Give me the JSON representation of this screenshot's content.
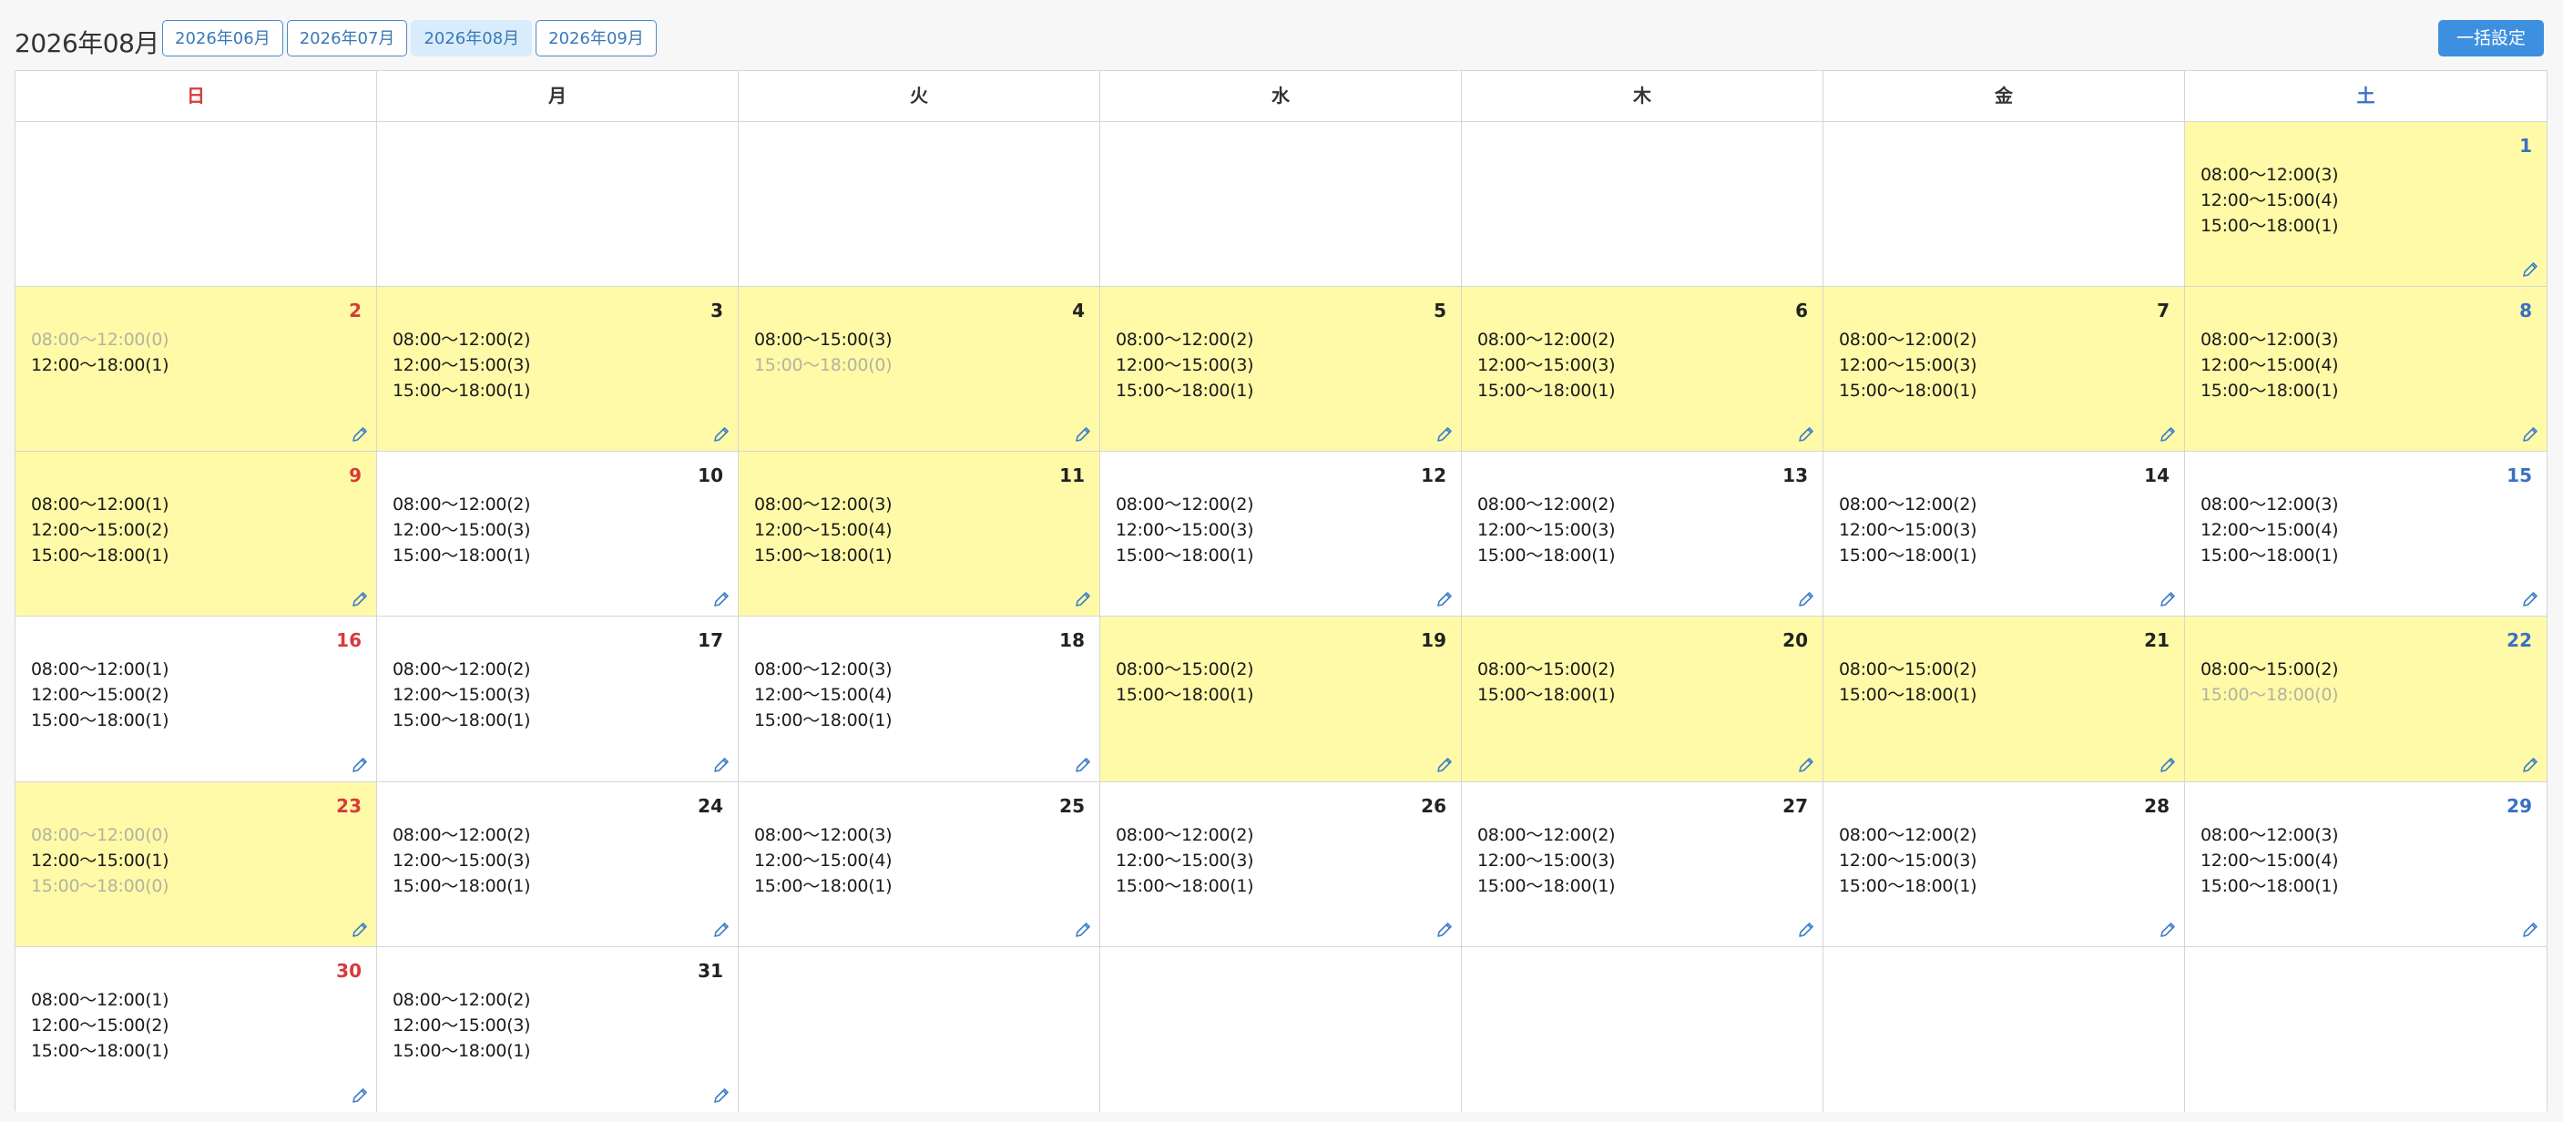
{
  "header": {
    "month_title": "2026年08月",
    "months": [
      {
        "label": "2026年06月",
        "active": false
      },
      {
        "label": "2026年07月",
        "active": false
      },
      {
        "label": "2026年08月",
        "active": true
      },
      {
        "label": "2026年09月",
        "active": false
      }
    ],
    "bulk_label": "一括設定"
  },
  "colors": {
    "highlight": "#fffaa8",
    "sunday": "#d83a3a",
    "saturday": "#3a6fc4",
    "accent": "#3d8fe0",
    "muted": "#b3b3a0"
  },
  "weekdays": [
    "日",
    "月",
    "火",
    "水",
    "木",
    "金",
    "土"
  ],
  "icons": {
    "edit": "pencil-icon"
  },
  "days": [
    {
      "day": "1",
      "highlight": true,
      "slots": [
        {
          "text": "08:00〜12:00(3)",
          "zero": false
        },
        {
          "text": "12:00〜15:00(4)",
          "zero": false
        },
        {
          "text": "15:00〜18:00(1)",
          "zero": false
        }
      ]
    },
    {
      "day": "2",
      "highlight": true,
      "slots": [
        {
          "text": "08:00〜12:00(0)",
          "zero": true
        },
        {
          "text": "12:00〜18:00(1)",
          "zero": false
        }
      ]
    },
    {
      "day": "3",
      "highlight": true,
      "slots": [
        {
          "text": "08:00〜12:00(2)",
          "zero": false
        },
        {
          "text": "12:00〜15:00(3)",
          "zero": false
        },
        {
          "text": "15:00〜18:00(1)",
          "zero": false
        }
      ]
    },
    {
      "day": "4",
      "highlight": true,
      "slots": [
        {
          "text": "08:00〜15:00(3)",
          "zero": false
        },
        {
          "text": "15:00〜18:00(0)",
          "zero": true
        }
      ]
    },
    {
      "day": "5",
      "highlight": true,
      "slots": [
        {
          "text": "08:00〜12:00(2)",
          "zero": false
        },
        {
          "text": "12:00〜15:00(3)",
          "zero": false
        },
        {
          "text": "15:00〜18:00(1)",
          "zero": false
        }
      ]
    },
    {
      "day": "6",
      "highlight": true,
      "slots": [
        {
          "text": "08:00〜12:00(2)",
          "zero": false
        },
        {
          "text": "12:00〜15:00(3)",
          "zero": false
        },
        {
          "text": "15:00〜18:00(1)",
          "zero": false
        }
      ]
    },
    {
      "day": "7",
      "highlight": true,
      "slots": [
        {
          "text": "08:00〜12:00(2)",
          "zero": false
        },
        {
          "text": "12:00〜15:00(3)",
          "zero": false
        },
        {
          "text": "15:00〜18:00(1)",
          "zero": false
        }
      ]
    },
    {
      "day": "8",
      "highlight": true,
      "slots": [
        {
          "text": "08:00〜12:00(3)",
          "zero": false
        },
        {
          "text": "12:00〜15:00(4)",
          "zero": false
        },
        {
          "text": "15:00〜18:00(1)",
          "zero": false
        }
      ]
    },
    {
      "day": "9",
      "highlight": true,
      "slots": [
        {
          "text": "08:00〜12:00(1)",
          "zero": false
        },
        {
          "text": "12:00〜15:00(2)",
          "zero": false
        },
        {
          "text": "15:00〜18:00(1)",
          "zero": false
        }
      ]
    },
    {
      "day": "10",
      "highlight": false,
      "slots": [
        {
          "text": "08:00〜12:00(2)",
          "zero": false
        },
        {
          "text": "12:00〜15:00(3)",
          "zero": false
        },
        {
          "text": "15:00〜18:00(1)",
          "zero": false
        }
      ]
    },
    {
      "day": "11",
      "highlight": true,
      "slots": [
        {
          "text": "08:00〜12:00(3)",
          "zero": false
        },
        {
          "text": "12:00〜15:00(4)",
          "zero": false
        },
        {
          "text": "15:00〜18:00(1)",
          "zero": false
        }
      ]
    },
    {
      "day": "12",
      "highlight": false,
      "slots": [
        {
          "text": "08:00〜12:00(2)",
          "zero": false
        },
        {
          "text": "12:00〜15:00(3)",
          "zero": false
        },
        {
          "text": "15:00〜18:00(1)",
          "zero": false
        }
      ]
    },
    {
      "day": "13",
      "highlight": false,
      "slots": [
        {
          "text": "08:00〜12:00(2)",
          "zero": false
        },
        {
          "text": "12:00〜15:00(3)",
          "zero": false
        },
        {
          "text": "15:00〜18:00(1)",
          "zero": false
        }
      ]
    },
    {
      "day": "14",
      "highlight": false,
      "slots": [
        {
          "text": "08:00〜12:00(2)",
          "zero": false
        },
        {
          "text": "12:00〜15:00(3)",
          "zero": false
        },
        {
          "text": "15:00〜18:00(1)",
          "zero": false
        }
      ]
    },
    {
      "day": "15",
      "highlight": false,
      "slots": [
        {
          "text": "08:00〜12:00(3)",
          "zero": false
        },
        {
          "text": "12:00〜15:00(4)",
          "zero": false
        },
        {
          "text": "15:00〜18:00(1)",
          "zero": false
        }
      ]
    },
    {
      "day": "16",
      "highlight": false,
      "slots": [
        {
          "text": "08:00〜12:00(1)",
          "zero": false
        },
        {
          "text": "12:00〜15:00(2)",
          "zero": false
        },
        {
          "text": "15:00〜18:00(1)",
          "zero": false
        }
      ]
    },
    {
      "day": "17",
      "highlight": false,
      "slots": [
        {
          "text": "08:00〜12:00(2)",
          "zero": false
        },
        {
          "text": "12:00〜15:00(3)",
          "zero": false
        },
        {
          "text": "15:00〜18:00(1)",
          "zero": false
        }
      ]
    },
    {
      "day": "18",
      "highlight": false,
      "slots": [
        {
          "text": "08:00〜12:00(3)",
          "zero": false
        },
        {
          "text": "12:00〜15:00(4)",
          "zero": false
        },
        {
          "text": "15:00〜18:00(1)",
          "zero": false
        }
      ]
    },
    {
      "day": "19",
      "highlight": true,
      "slots": [
        {
          "text": "08:00〜15:00(2)",
          "zero": false
        },
        {
          "text": "15:00〜18:00(1)",
          "zero": false
        }
      ]
    },
    {
      "day": "20",
      "highlight": true,
      "slots": [
        {
          "text": "08:00〜15:00(2)",
          "zero": false
        },
        {
          "text": "15:00〜18:00(1)",
          "zero": false
        }
      ]
    },
    {
      "day": "21",
      "highlight": true,
      "slots": [
        {
          "text": "08:00〜15:00(2)",
          "zero": false
        },
        {
          "text": "15:00〜18:00(1)",
          "zero": false
        }
      ]
    },
    {
      "day": "22",
      "highlight": true,
      "slots": [
        {
          "text": "08:00〜15:00(2)",
          "zero": false
        },
        {
          "text": "15:00〜18:00(0)",
          "zero": true
        }
      ]
    },
    {
      "day": "23",
      "highlight": true,
      "slots": [
        {
          "text": "08:00〜12:00(0)",
          "zero": true
        },
        {
          "text": "12:00〜15:00(1)",
          "zero": false
        },
        {
          "text": "15:00〜18:00(0)",
          "zero": true
        }
      ]
    },
    {
      "day": "24",
      "highlight": false,
      "slots": [
        {
          "text": "08:00〜12:00(2)",
          "zero": false
        },
        {
          "text": "12:00〜15:00(3)",
          "zero": false
        },
        {
          "text": "15:00〜18:00(1)",
          "zero": false
        }
      ]
    },
    {
      "day": "25",
      "highlight": false,
      "slots": [
        {
          "text": "08:00〜12:00(3)",
          "zero": false
        },
        {
          "text": "12:00〜15:00(4)",
          "zero": false
        },
        {
          "text": "15:00〜18:00(1)",
          "zero": false
        }
      ]
    },
    {
      "day": "26",
      "highlight": false,
      "slots": [
        {
          "text": "08:00〜12:00(2)",
          "zero": false
        },
        {
          "text": "12:00〜15:00(3)",
          "zero": false
        },
        {
          "text": "15:00〜18:00(1)",
          "zero": false
        }
      ]
    },
    {
      "day": "27",
      "highlight": false,
      "slots": [
        {
          "text": "08:00〜12:00(2)",
          "zero": false
        },
        {
          "text": "12:00〜15:00(3)",
          "zero": false
        },
        {
          "text": "15:00〜18:00(1)",
          "zero": false
        }
      ]
    },
    {
      "day": "28",
      "highlight": false,
      "slots": [
        {
          "text": "08:00〜12:00(2)",
          "zero": false
        },
        {
          "text": "12:00〜15:00(3)",
          "zero": false
        },
        {
          "text": "15:00〜18:00(1)",
          "zero": false
        }
      ]
    },
    {
      "day": "29",
      "highlight": false,
      "slots": [
        {
          "text": "08:00〜12:00(3)",
          "zero": false
        },
        {
          "text": "12:00〜15:00(4)",
          "zero": false
        },
        {
          "text": "15:00〜18:00(1)",
          "zero": false
        }
      ]
    },
    {
      "day": "30",
      "highlight": false,
      "slots": [
        {
          "text": "08:00〜12:00(1)",
          "zero": false
        },
        {
          "text": "12:00〜15:00(2)",
          "zero": false
        },
        {
          "text": "15:00〜18:00(1)",
          "zero": false
        }
      ]
    },
    {
      "day": "31",
      "highlight": false,
      "slots": [
        {
          "text": "08:00〜12:00(2)",
          "zero": false
        },
        {
          "text": "12:00〜15:00(3)",
          "zero": false
        },
        {
          "text": "15:00〜18:00(1)",
          "zero": false
        }
      ]
    }
  ]
}
